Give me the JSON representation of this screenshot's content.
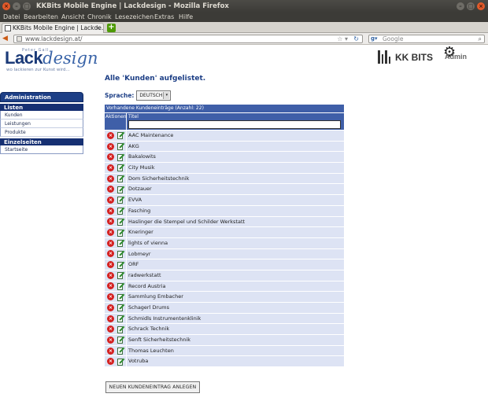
{
  "window": {
    "title": "KKBits Mobile Engine | Lackdesign - Mozilla Firefox"
  },
  "menu": [
    "Datei",
    "Bearbeiten",
    "Ansicht",
    "Chronik",
    "Lesezeichen",
    "Extras",
    "Hilfe"
  ],
  "tab": {
    "label": "KKBits Mobile Engine | Lackde...",
    "close": "×",
    "new": "+"
  },
  "nav": {
    "url": "www.lackdesign.at/",
    "search_placeholder": "Google"
  },
  "header": {
    "logo_lack": "Lack",
    "logo_design": "design",
    "logo_top": "Peter Gall",
    "logo_tagline": "wo lackieren zur Kunst wird...",
    "brand": "KK BITS",
    "admin": "Admin"
  },
  "sidebar": {
    "title": "Administration",
    "sections": [
      {
        "label": "Listen",
        "items": [
          "Kunden",
          "Leistungen",
          "Produkte"
        ]
      },
      {
        "label": "Einzelseiten",
        "items": [
          "Startseite"
        ]
      }
    ]
  },
  "main": {
    "heading": "Alle 'Kunden' aufgelistet.",
    "language_label": "Sprache:",
    "language_value": "DEUTSCH",
    "table_caption": "Vorhandene Kundeneinträge (Anzahl: 22)",
    "col_actions": "Aktionen",
    "col_title": "Titel",
    "rows": [
      "AAC Maintenance",
      "AKG",
      "Bakalowits",
      "City Musik",
      "Dom Sicherheitstechnik",
      "Dotzauer",
      "EVVA",
      "Fasching",
      "Haslinger die Stempel und Schilder Werkstatt",
      "Kneringer",
      "lights of vienna",
      "Lobmeyr",
      "ORF",
      "radwerkstatt",
      "Record Austria",
      "Sammlung Embacher",
      "Schagerl Drums",
      "Schmidls Instrumentenklinik",
      "Schrack Technik",
      "Senft Sicherheitstechnik",
      "Thomas Leuchten",
      "Votruba"
    ],
    "new_button": "NEUEN KUNDENEINTRAG ANLEGEN"
  },
  "colors": {
    "brand_blue": "#1d3f86",
    "table_header": "#3f5fa8",
    "row_bg": "#dde3f4",
    "delete_red": "#d42020",
    "edit_green": "#2e8b2e"
  }
}
